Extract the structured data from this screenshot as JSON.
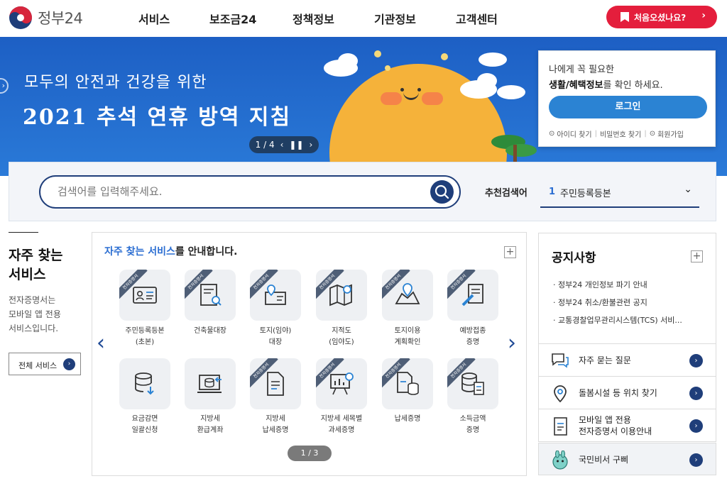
{
  "header": {
    "logo_text": "정부24",
    "nav": [
      "서비스",
      "보조금24",
      "정책정보",
      "기관정보",
      "고객센터"
    ],
    "cta_label": "처음오셨나요?"
  },
  "banner": {
    "line1": "모두의 안전과 건강을 위한",
    "line2": "2021 추석 연휴 방역 지침",
    "pager": "1 / 4"
  },
  "login": {
    "line1": "나에게 꼭 필요한",
    "line2_bold": "생활/혜택정보",
    "line2_rest": "를 확인 하세요.",
    "button": "로그인",
    "links": [
      "아이디 찾기",
      "비밀번호 찾기",
      "회원가입"
    ]
  },
  "search": {
    "placeholder": "검색어를 입력해주세요.",
    "recommend_label": "추천검색어",
    "recommend_num": "1",
    "recommend_term": "주민등록등본"
  },
  "frequent": {
    "title_line1": "자주 찾는",
    "title_line2": "서비스",
    "desc1": "전자증명서는",
    "desc2": "모바일 앱 전용",
    "desc3": "서비스입니다.",
    "all_button": "전체 서비스"
  },
  "services": {
    "heading_highlight": "자주 찾는 서비스",
    "heading_rest": "를 안내합니다.",
    "pager": "1 / 3",
    "ribbon": "전자증명서",
    "items": [
      {
        "l1": "주민등록등본",
        "l2": "(초본)"
      },
      {
        "l1": "건축물대장",
        "l2": ""
      },
      {
        "l1": "토지(임야)",
        "l2": "대장"
      },
      {
        "l1": "지적도",
        "l2": "(임야도)"
      },
      {
        "l1": "토지이용",
        "l2": "계획확인"
      },
      {
        "l1": "예방접종",
        "l2": "증명"
      },
      {
        "l1": "요금감면",
        "l2": "일괄신청"
      },
      {
        "l1": "지방세",
        "l2": "환급계좌"
      },
      {
        "l1": "지방세",
        "l2": "납세증명"
      },
      {
        "l1": "지방세 세목별",
        "l2": "과세증명"
      },
      {
        "l1": "납세증명",
        "l2": ""
      },
      {
        "l1": "소득금액",
        "l2": "증명"
      }
    ]
  },
  "notice": {
    "title": "공지사항",
    "items": [
      "정부24 개인정보 파기 안내",
      "정부24 취소/환불관련 공지",
      "교통경찰업무관리시스템(TCS) 서비..."
    ]
  },
  "quick": [
    {
      "l1": "자주 묻는 질문",
      "l2": ""
    },
    {
      "l1": "돌봄시설 등 위치 찾기",
      "l2": ""
    },
    {
      "l1": "모바일 앱 전용",
      "l2": "전자증명서 이용안내"
    },
    {
      "l1": "국민비서 구삐",
      "l2": ""
    }
  ],
  "colors": {
    "brand_navy": "#1f3e7a",
    "banner_blue": "#1d5fc4",
    "cta_red": "#e41e3c",
    "link_blue": "#2b6ed2",
    "login_blue": "#2b83d3"
  }
}
